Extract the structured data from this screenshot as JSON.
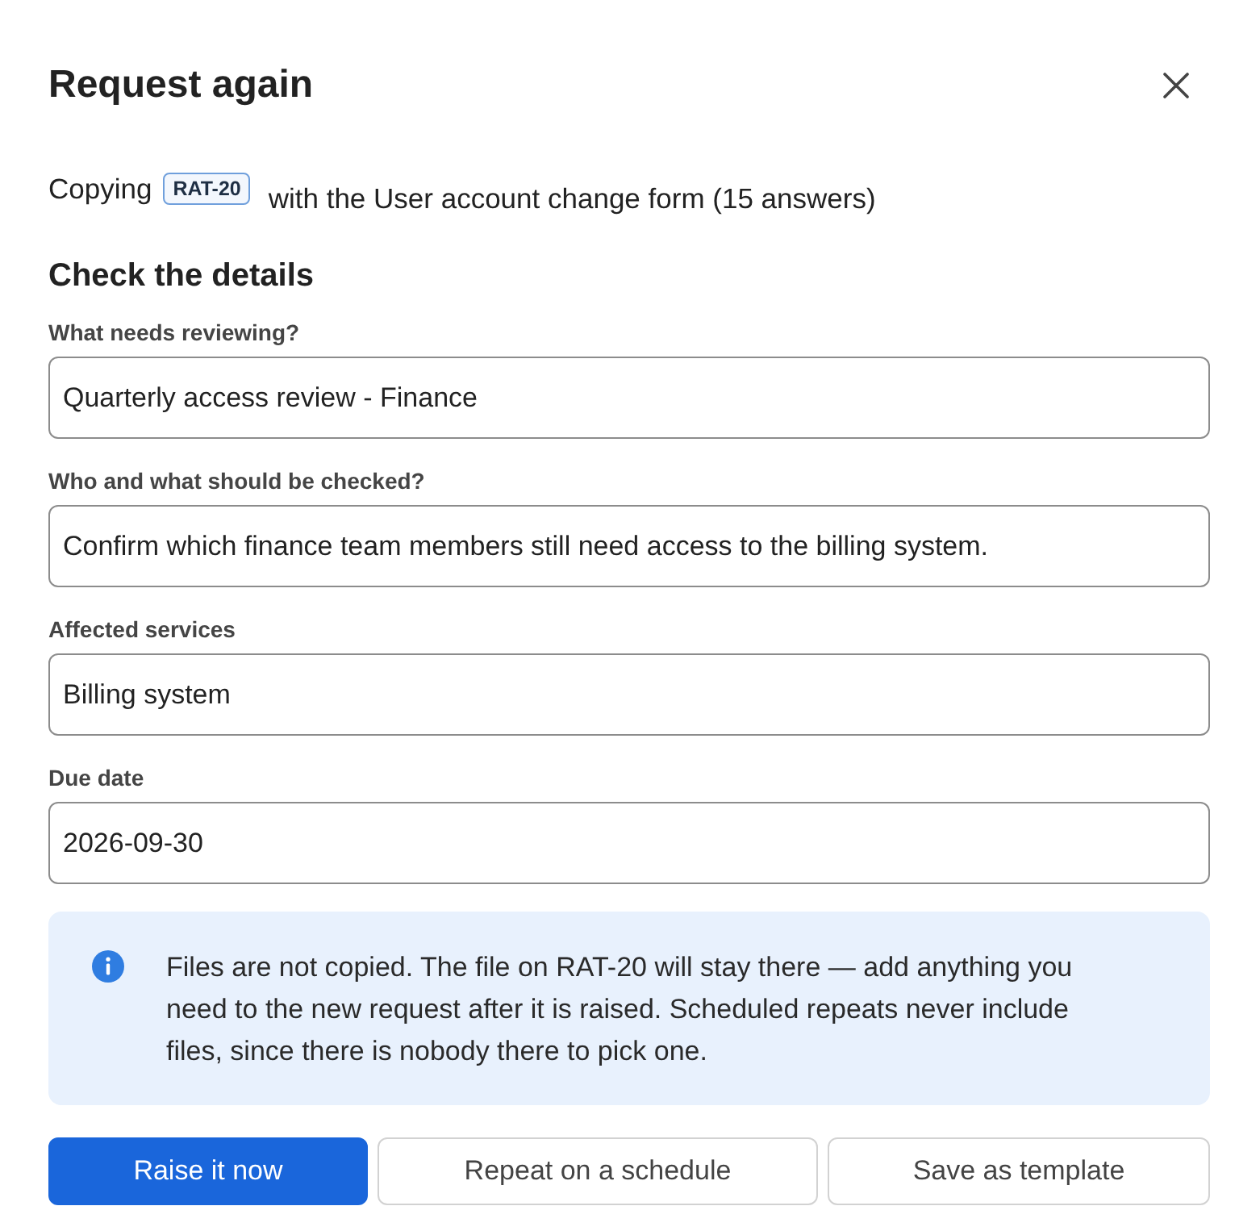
{
  "dialog": {
    "title": "Request again"
  },
  "intro": {
    "prefix": "Copying",
    "ticket": "RAT-20",
    "suffix": "with the User account change form (15 answers)"
  },
  "section": {
    "title": "Check the details"
  },
  "fields": [
    {
      "label": "What needs reviewing?",
      "value": "Quarterly access review - Finance"
    },
    {
      "label": "Who and what should be checked?",
      "value": "Confirm which finance team members still need access to the billing system."
    },
    {
      "label": "Affected services",
      "value": "Billing system"
    },
    {
      "label": "Due date",
      "value": "2026-09-30"
    }
  ],
  "notice": {
    "kind": "info",
    "text": "Files are not copied. The file on RAT-20 will stay there — add anything you need to the new request after it is raised. Scheduled repeats never include files, since there is nobody there to pick one."
  },
  "buttons": [
    {
      "label": "Raise it now",
      "kind": "primary"
    },
    {
      "label": "Repeat on a schedule",
      "kind": "secondary"
    },
    {
      "label": "Save as template",
      "kind": "secondary"
    }
  ]
}
